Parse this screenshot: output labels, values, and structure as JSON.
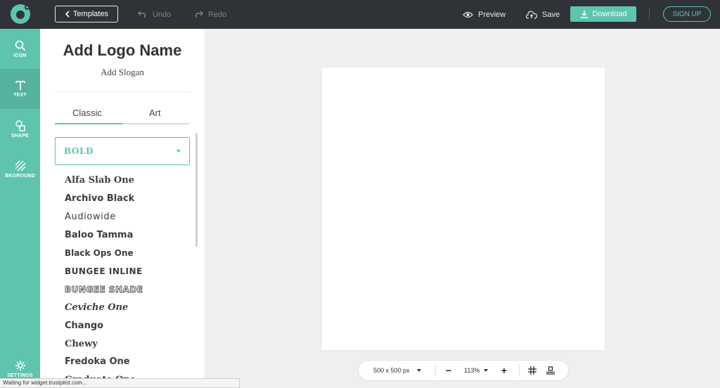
{
  "topbar": {
    "templates_label": "Templates",
    "undo_label": "Undo",
    "redo_label": "Redo",
    "preview_label": "Preview",
    "save_label": "Save",
    "download_label": "Download",
    "signup_label": "SIGN UP"
  },
  "rail": {
    "items": [
      {
        "label": "ICON",
        "icon": "search-icon"
      },
      {
        "label": "TEXT",
        "icon": "text-icon",
        "active": true
      },
      {
        "label": "SHAPE",
        "icon": "shapes-icon"
      },
      {
        "label": "BKGROUND",
        "icon": "background-icon"
      }
    ],
    "settings_label": "SETTINGS"
  },
  "panel": {
    "logo_name": "Add Logo Name",
    "slogan": "Add Slogan",
    "tabs": [
      {
        "label": "Classic",
        "active": true
      },
      {
        "label": "Art",
        "active": false
      }
    ],
    "category_value": "BOLD",
    "fonts": [
      "Alfa Slab One",
      "Archivo Black",
      "Audiowide",
      "Baloo Tamma",
      "Black Ops One",
      "BUNGEE INLINE",
      "BUNGEE SHADE",
      "Ceviche One",
      "Chango",
      "Chewy",
      "Fredoka One",
      "Graduate One"
    ]
  },
  "canvas": {
    "size_label": "500 x 500 px",
    "zoom_label": "113%",
    "minus_label": "−",
    "plus_label": "+"
  },
  "status_text": "Waiting for widget.trustpilot.com...",
  "colors": {
    "accent": "#5ec4ae",
    "topbar": "#2f3337"
  }
}
